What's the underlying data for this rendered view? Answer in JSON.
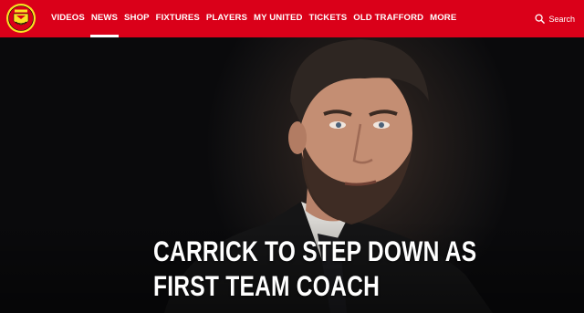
{
  "nav": {
    "logo_icon": "manchester-united-crest-icon",
    "items": [
      {
        "label": "VIDEOS",
        "active": false
      },
      {
        "label": "NEWS",
        "active": true
      },
      {
        "label": "SHOP",
        "active": false
      },
      {
        "label": "FIXTURES",
        "active": false
      },
      {
        "label": "PLAYERS",
        "active": false
      },
      {
        "label": "MY UNITED",
        "active": false
      },
      {
        "label": "TICKETS",
        "active": false
      },
      {
        "label": "OLD TRAFFORD",
        "active": false
      },
      {
        "label": "MORE",
        "active": false
      }
    ],
    "search_label": "Search",
    "search_icon": "search-icon"
  },
  "hero": {
    "headline_line1": "CARRICK TO STEP DOWN AS",
    "headline_line2": "FIRST TEAM COACH"
  },
  "colors": {
    "brand_red": "#da0019",
    "crest_gold": "#fbe122",
    "text": "#ffffff"
  }
}
